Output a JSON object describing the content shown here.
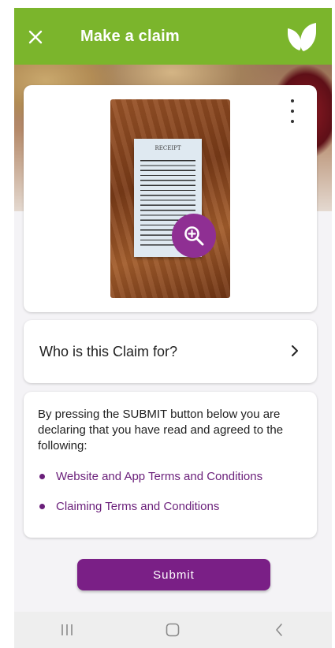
{
  "header": {
    "title": "Make a claim",
    "close_icon": "close-icon",
    "logo_icon": "leaf-logo-icon",
    "bg_color": "#7bb52c"
  },
  "receipt_card": {
    "menu_icon": "more-vertical-icon",
    "receipt_title": "RECEIPT",
    "zoom_icon": "zoom-in-icon"
  },
  "who_card": {
    "label": "Who is this Claim for?",
    "chevron_icon": "chevron-right-icon"
  },
  "terms_card": {
    "text": "By pressing the SUBMIT button below you are declaring that you have read and agreed to the following:",
    "links": [
      {
        "label": "Website and App Terms and Conditions"
      },
      {
        "label": "Claiming Terms and Conditions"
      }
    ],
    "link_color": "#6a1f7a"
  },
  "submit": {
    "label": "Submit",
    "color": "#7a1f86"
  },
  "navbar": {
    "recents_icon": "recents-icon",
    "home_icon": "home-icon",
    "back_icon": "back-icon"
  }
}
